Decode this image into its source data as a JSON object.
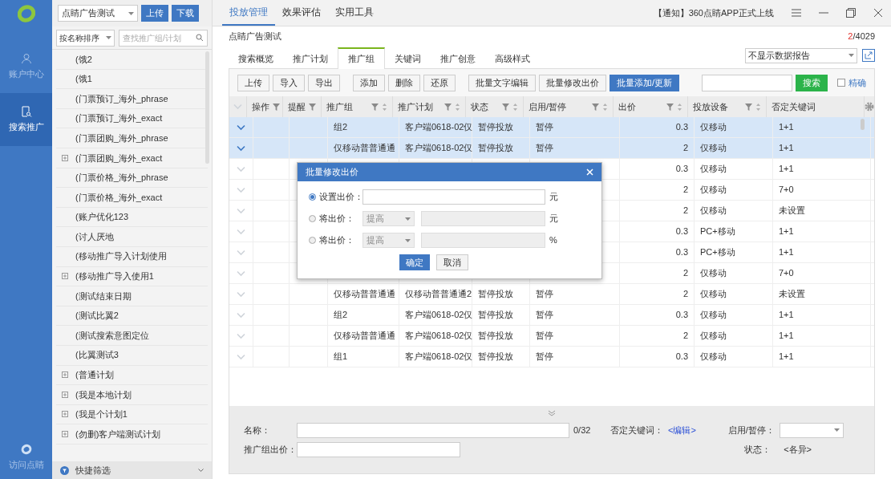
{
  "nav": {
    "items": [
      {
        "label": "账户中心",
        "selected": false
      },
      {
        "label": "搜索推广",
        "selected": true
      }
    ],
    "footer": "访问点睛"
  },
  "sidebar": {
    "account": "点睛广告测试",
    "buttons": [
      "上传",
      "下载"
    ],
    "sort": "按名称排序",
    "search_placeholder": "查找推广组/计划",
    "items": [
      {
        "label": "(饿2",
        "expandable": false
      },
      {
        "label": "(饿1",
        "expandable": false
      },
      {
        "label": "(门票预订_海外_phrase",
        "expandable": false
      },
      {
        "label": "(门票预订_海外_exact",
        "expandable": false
      },
      {
        "label": "(门票团购_海外_phrase",
        "expandable": false
      },
      {
        "label": "(门票团购_海外_exact",
        "expandable": true
      },
      {
        "label": "(门票价格_海外_phrase",
        "expandable": false
      },
      {
        "label": "(门票价格_海外_exact",
        "expandable": false
      },
      {
        "label": "(账户优化123",
        "expandable": false
      },
      {
        "label": "(讨人厌地",
        "expandable": false
      },
      {
        "label": "(移动推广导入计划使用",
        "expandable": false
      },
      {
        "label": "(移动推广导入使用1",
        "expandable": true
      },
      {
        "label": "(测试结束日期",
        "expandable": false
      },
      {
        "label": "(测试比翼2",
        "expandable": false
      },
      {
        "label": "(测试搜索意图定位",
        "expandable": false
      },
      {
        "label": "(比翼测试3",
        "expandable": false
      },
      {
        "label": "(普通计划",
        "expandable": true
      },
      {
        "label": "(我是本地计划",
        "expandable": true
      },
      {
        "label": "(我是个计划1",
        "expandable": true
      },
      {
        "label": "(勿删)客户端测试计划",
        "expandable": true
      }
    ],
    "quick_filter": "快捷筛选"
  },
  "topbar": {
    "tabs": [
      {
        "label": "投放管理",
        "selected": true
      },
      {
        "label": "效果评估",
        "selected": false
      },
      {
        "label": "实用工具",
        "selected": false
      }
    ],
    "notice": "【通知】360点睛APP正式上线"
  },
  "breadcrumb": "点睛广告测试",
  "count_current": "2",
  "count_total": "/4029",
  "subtabs": [
    {
      "label": "搜索概览",
      "selected": false
    },
    {
      "label": "推广计划",
      "selected": false
    },
    {
      "label": "推广组",
      "selected": true
    },
    {
      "label": "关键词",
      "selected": false
    },
    {
      "label": "推广创意",
      "selected": false
    },
    {
      "label": "高级样式",
      "selected": false
    }
  ],
  "report_select": "不显示数据报告",
  "toolbar": {
    "groups": [
      [
        {
          "label": "上传",
          "kind": "plain"
        },
        {
          "label": "导入",
          "kind": "plain"
        },
        {
          "label": "导出",
          "kind": "plain"
        }
      ],
      [
        {
          "label": "添加",
          "kind": "plain"
        },
        {
          "label": "删除",
          "kind": "plain"
        },
        {
          "label": "还原",
          "kind": "plain"
        }
      ],
      [
        {
          "label": "批量文字编辑",
          "kind": "plain"
        },
        {
          "label": "批量修改出价",
          "kind": "plain"
        },
        {
          "label": "批量添加/更新",
          "kind": "primary"
        }
      ]
    ],
    "search_button": "搜索",
    "exact": {
      "label": "精确",
      "checked": false
    }
  },
  "table": {
    "columns": [
      {
        "label": "操作",
        "filter": true,
        "sort": false
      },
      {
        "label": "提醒",
        "filter": true,
        "sort": false
      },
      {
        "label": "推广组",
        "filter": true,
        "sort": true
      },
      {
        "label": "推广计划",
        "filter": true,
        "sort": true
      },
      {
        "label": "状态",
        "filter": true,
        "sort": true
      },
      {
        "label": "启用/暂停",
        "filter": true,
        "sort": true
      },
      {
        "label": "出价",
        "filter": true,
        "sort": true
      },
      {
        "label": "投放设备",
        "filter": true,
        "sort": true
      },
      {
        "label": "否定关键词",
        "filter": false,
        "sort": false
      }
    ],
    "rows": [
      {
        "selected": true,
        "group": "组2",
        "plan": "客户端0618-02仅",
        "status": "暂停投放",
        "enabled": "暂停",
        "bid": "0.3",
        "device": "仅移动",
        "negative": "1+1"
      },
      {
        "selected": true,
        "group": "仅移动普普通通",
        "plan": "客户端0618-02仅",
        "status": "暂停投放",
        "enabled": "暂停",
        "bid": "2",
        "device": "仅移动",
        "negative": "1+1"
      },
      {
        "selected": false,
        "bid": "0.3",
        "device": "仅移动",
        "negative": "1+1"
      },
      {
        "selected": false,
        "bid": "2",
        "device": "仅移动",
        "negative": "7+0"
      },
      {
        "selected": false,
        "bid": "2",
        "device": "仅移动",
        "negative": "未设置"
      },
      {
        "selected": false,
        "bid": "0.3",
        "device": "PC+移动",
        "negative": "1+1"
      },
      {
        "selected": false,
        "bid": "0.3",
        "device": "PC+移动",
        "negative": "1+1"
      },
      {
        "selected": false,
        "bid": "2",
        "device": "仅移动",
        "negative": "7+0"
      },
      {
        "selected": false,
        "group": "仅移动普普通通",
        "plan": "仅移动普普通通2",
        "status": "暂停投放",
        "enabled": "暂停",
        "bid": "2",
        "device": "仅移动",
        "negative": "未设置"
      },
      {
        "selected": false,
        "group": "组2",
        "plan": "客户端0618-02仅",
        "status": "暂停投放",
        "enabled": "暂停",
        "bid": "0.3",
        "device": "仅移动",
        "negative": "1+1"
      },
      {
        "selected": false,
        "group": "仅移动普普通通",
        "plan": "客户端0618-02仅",
        "status": "暂停投放",
        "enabled": "暂停",
        "bid": "2",
        "device": "仅移动",
        "negative": "1+1"
      },
      {
        "selected": false,
        "group": "组1",
        "plan": "客户端0618-02仅",
        "status": "暂停投放",
        "enabled": "暂停",
        "bid": "0.3",
        "device": "仅移动",
        "negative": "1+1"
      }
    ]
  },
  "dialog": {
    "title": "批量修改出价",
    "options": [
      {
        "label": "设置出价：",
        "kind": "input",
        "selected": true,
        "unit": "元"
      },
      {
        "label": "将出价：",
        "kind": "select_input",
        "selected": false,
        "select": "提高",
        "unit": "元"
      },
      {
        "label": "将出价：",
        "kind": "select_input",
        "selected": false,
        "select": "提高",
        "unit": "%"
      }
    ],
    "ok": "确定",
    "cancel": "取消"
  },
  "details": {
    "name_label": "名称：",
    "name_counter": "0/32",
    "negative_label": "否定关键词：",
    "negative_link": "<编辑>",
    "enabled_label": "启用/暂停：",
    "bid_label": "推广组出价：",
    "status_label": "状态：",
    "status_value": "<各异>"
  }
}
